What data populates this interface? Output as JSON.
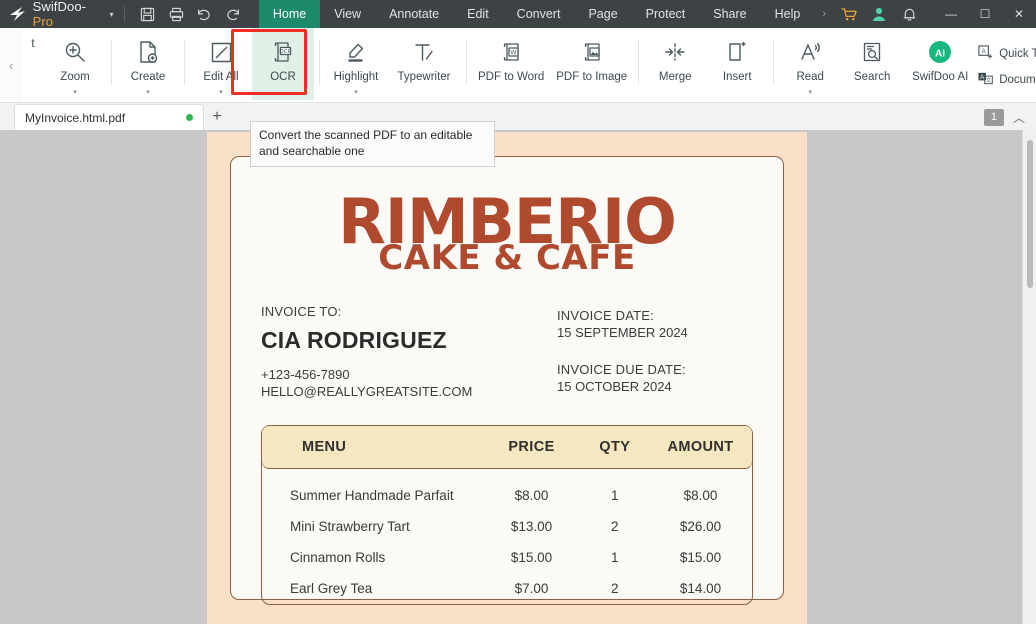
{
  "titlebar": {
    "brand": "SwifDoo",
    "brand_suffix": "Pro",
    "caret": "▾",
    "quick_actions": [
      {
        "name": "save-icon",
        "glyph": "save"
      },
      {
        "name": "print-icon",
        "glyph": "print"
      },
      {
        "name": "undo-icon",
        "glyph": "undo"
      },
      {
        "name": "redo-icon",
        "glyph": "redo"
      }
    ],
    "tabs": [
      {
        "label": "Home",
        "active": true
      },
      {
        "label": "View",
        "active": false
      },
      {
        "label": "Annotate",
        "active": false
      },
      {
        "label": "Edit",
        "active": false
      },
      {
        "label": "Convert",
        "active": false
      },
      {
        "label": "Page",
        "active": false
      },
      {
        "label": "Protect",
        "active": false
      },
      {
        "label": "Share",
        "active": false
      },
      {
        "label": "Help",
        "active": false
      }
    ],
    "overflow_chevron": "›",
    "right_icons": [
      {
        "name": "cart-icon",
        "color": "#f0a32e"
      },
      {
        "name": "account-icon",
        "color": "#4fd1a5"
      },
      {
        "name": "notification-bell-icon",
        "color": "#d8d8d8"
      }
    ],
    "window_buttons": {
      "minimize": "—",
      "maximize": "☐",
      "close": "✕"
    },
    "accent_green": "#1d8a6c"
  },
  "ribbon": {
    "scroll_left": "‹",
    "scroll_right": "›",
    "clipped_label": "t",
    "items": [
      {
        "label": "Zoom",
        "icon": "zoom-in-icon",
        "caret": "▾"
      },
      {
        "label": "Create",
        "icon": "create-pdf-icon",
        "caret": "▾"
      },
      {
        "label": "Edit All",
        "icon": "edit-all-icon",
        "caret": "▾"
      },
      {
        "label": "OCR",
        "icon": "ocr-icon",
        "caret": "",
        "highlighted": true
      },
      {
        "label": "Highlight",
        "icon": "highlight-icon",
        "caret": "▾"
      },
      {
        "label": "Typewriter",
        "icon": "typewriter-icon",
        "caret": ""
      },
      {
        "label": "PDF to Word",
        "icon": "pdf-to-word-icon",
        "caret": ""
      },
      {
        "label": "PDF to Image",
        "icon": "pdf-to-image-icon",
        "caret": ""
      },
      {
        "label": "Merge",
        "icon": "merge-icon",
        "caret": ""
      },
      {
        "label": "Insert",
        "icon": "insert-page-icon",
        "caret": ""
      },
      {
        "label": "Read",
        "icon": "read-aloud-icon",
        "caret": "▾"
      },
      {
        "label": "Search",
        "icon": "search-icon",
        "caret": ""
      },
      {
        "label": "SwifDoo AI",
        "icon": "ai-icon",
        "caret": ""
      }
    ],
    "stacked_items": [
      {
        "label": "Quick Ti",
        "icon": "quick-tips-icon"
      },
      {
        "label": "Docum",
        "icon": "document-translate-icon"
      }
    ],
    "highlight_color": "#ee2d24",
    "highlight_bg": "#dff0e6"
  },
  "tooltip": {
    "text": "Convert the scanned PDF to an editable and searchable one"
  },
  "tabstrip": {
    "document_tab": "MyInvoice.html.pdf",
    "modified_dot": true,
    "add_tab": "+",
    "page_number": "1",
    "collapse_chevron": "︿"
  },
  "document": {
    "logo_line1": "RIMBERIO",
    "logo_line2": "CAKE & CAFE",
    "logo_color": "#b04a2e",
    "page_bg": "#fae0c8",
    "invoice_to_label": "INVOICE TO:",
    "customer_name": "CIA RODRIGUEZ",
    "customer_phone": "+123-456-7890",
    "customer_email": "HELLO@REALLYGREATSITE.COM",
    "invoice_date_label": "INVOICE DATE:",
    "invoice_date": "15 SEPTEMBER 2024",
    "invoice_due_label": "INVOICE DUE DATE:",
    "invoice_due": "15 OCTOBER 2024",
    "table": {
      "headers": [
        "MENU",
        "PRICE",
        "QTY",
        "AMOUNT"
      ],
      "header_bg": "#f5e7c0",
      "border_color": "#8a6243",
      "rows": [
        {
          "menu": "Summer Handmade Parfait",
          "price": "$8.00",
          "qty": "1",
          "amount": "$8.00"
        },
        {
          "menu": "Mini Strawberry Tart",
          "price": "$13.00",
          "qty": "2",
          "amount": "$26.00"
        },
        {
          "menu": "Cinnamon Rolls",
          "price": "$15.00",
          "qty": "1",
          "amount": "$15.00"
        },
        {
          "menu": "Earl Grey Tea",
          "price": "$7.00",
          "qty": "2",
          "amount": "$14.00"
        }
      ]
    }
  }
}
